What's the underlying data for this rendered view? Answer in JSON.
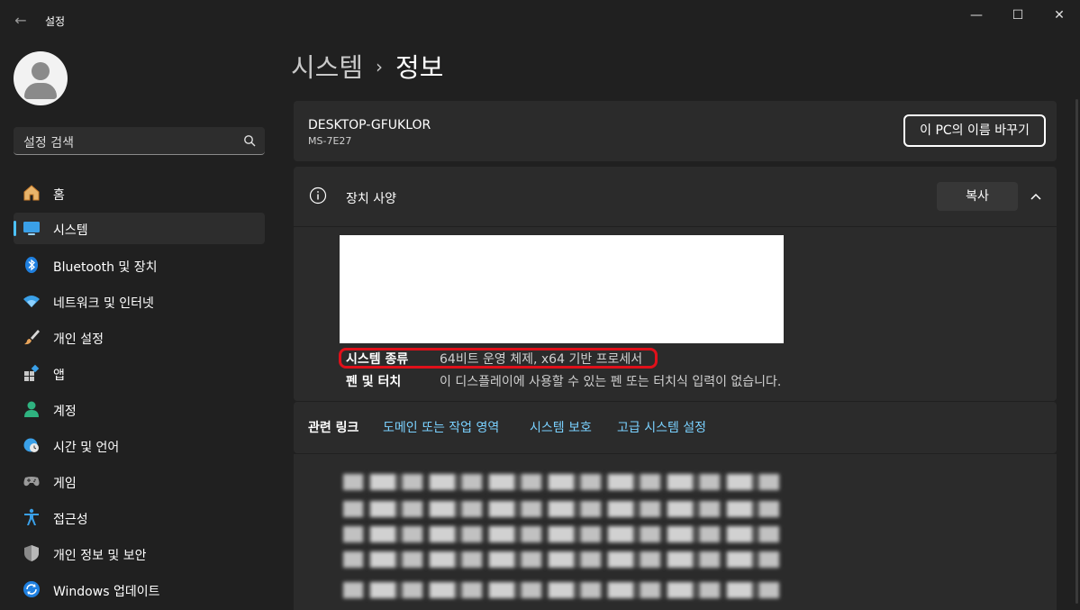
{
  "window": {
    "title": "설정",
    "back_icon": "back-arrow-icon",
    "minimize": "—",
    "maximize": "☐",
    "close": "✕"
  },
  "sidebar": {
    "search_placeholder": "설정 검색",
    "items": [
      {
        "label": "홈",
        "icon": "home-icon"
      },
      {
        "label": "시스템",
        "icon": "system-icon",
        "active": true
      },
      {
        "label": "Bluetooth 및 장치",
        "icon": "bluetooth-icon"
      },
      {
        "label": "네트워크 및 인터넷",
        "icon": "wifi-icon"
      },
      {
        "label": "개인 설정",
        "icon": "brush-icon"
      },
      {
        "label": "앱",
        "icon": "apps-icon"
      },
      {
        "label": "계정",
        "icon": "account-icon"
      },
      {
        "label": "시간 및 언어",
        "icon": "globe-clock-icon"
      },
      {
        "label": "게임",
        "icon": "gamepad-icon"
      },
      {
        "label": "접근성",
        "icon": "accessibility-icon"
      },
      {
        "label": "개인 정보 및 보안",
        "icon": "shield-icon"
      },
      {
        "label": "Windows 업데이트",
        "icon": "update-icon"
      }
    ]
  },
  "breadcrumb": {
    "parent": "시스템",
    "separator": "›",
    "current": "정보"
  },
  "device": {
    "name": "DESKTOP-GFUKLOR",
    "model": "MS-7E27",
    "rename_button": "이 PC의 이름 바꾸기"
  },
  "specs": {
    "title": "장치 사양",
    "copy_button": "복사",
    "rows": [
      {
        "key": "시스템 종류",
        "value": "64비트 운영 체제, x64 기반 프로세서"
      },
      {
        "key": "펜 및 터치",
        "value": "이 디스플레이에 사용할 수 있는 펜 또는 터치식 입력이 없습니다."
      }
    ]
  },
  "related_links": {
    "title": "관련 링크",
    "links": [
      "도메인 또는 작업 영역",
      "시스템 보호",
      "고급 시스템 설정"
    ]
  },
  "colors": {
    "accent": "#4cc2ff",
    "link": "#7ad1ff",
    "highlight": "#e0101a"
  }
}
